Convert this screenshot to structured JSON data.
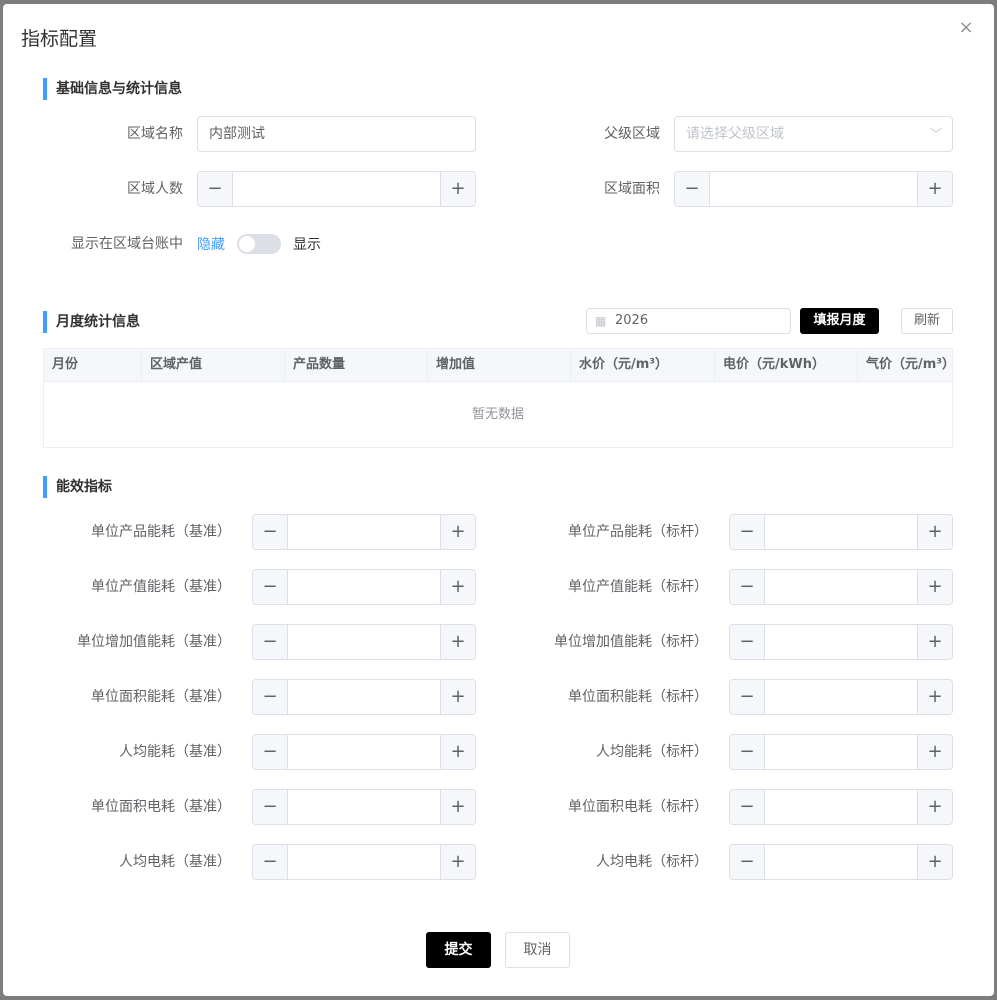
{
  "dialog": {
    "title": "指标配置",
    "close_icon": "×"
  },
  "basic": {
    "section_title": "基础信息与统计信息",
    "area_name_label": "区域名称",
    "area_name_value": "内部测试",
    "parent_area_label": "父级区域",
    "parent_area_placeholder": "请选择父级区域",
    "population_label": "区域人数",
    "area_size_label": "区域面积",
    "show_in_ledger_label": "显示在区域台账中",
    "switch_off_text": "隐藏",
    "switch_on_text": "显示",
    "switch_state": "off"
  },
  "stepper": {
    "minus": "−",
    "plus": "+"
  },
  "monthly": {
    "section_title": "月度统计信息",
    "year_value": "2026",
    "fill_button": "填报月度",
    "refresh_button": "刷新",
    "columns": [
      "月份",
      "区域产值",
      "产品数量",
      "增加值",
      "水价（元/m³）",
      "电价（元/kWh）",
      "气价（元/m³）"
    ],
    "empty_text": "暂无数据"
  },
  "efficiency": {
    "section_title": "能效指标",
    "left_labels": [
      "单位产品能耗（基准）",
      "单位产值能耗（基准）",
      "单位增加值能耗（基准）",
      "单位面积能耗（基准）",
      "人均能耗（基准）",
      "单位面积电耗（基准）",
      "人均电耗（基准）"
    ],
    "right_labels": [
      "单位产品能耗（标杆）",
      "单位产值能耗（标杆）",
      "单位增加值能耗（标杆）",
      "单位面积能耗（标杆）",
      "人均能耗（标杆）",
      "单位面积电耗（标杆）",
      "人均电耗（标杆）"
    ]
  },
  "footer": {
    "submit_button": "提交",
    "cancel_button": "取消"
  },
  "colors": {
    "accent": "#409eff",
    "dark_button": "#000000"
  }
}
